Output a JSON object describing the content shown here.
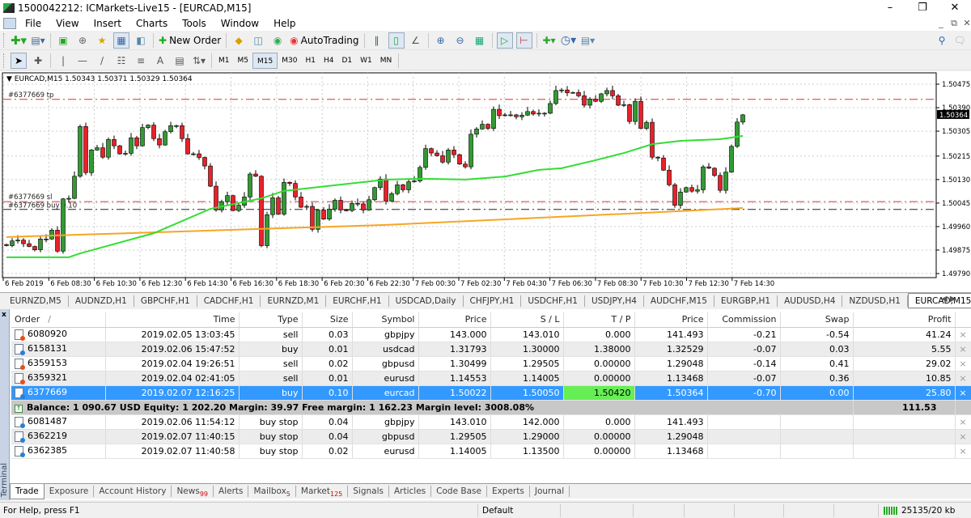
{
  "window": {
    "title": "1500042212: ICMarkets-Live15 - [EURCAD,M15]",
    "controls": [
      "minimize",
      "restore",
      "close"
    ]
  },
  "menu": {
    "items": [
      "File",
      "View",
      "Insert",
      "Charts",
      "Tools",
      "Window",
      "Help"
    ]
  },
  "toolbar": {
    "new_order": "New Order",
    "autotrading": "AutoTrading",
    "timeframes": [
      "M1",
      "M5",
      "M15",
      "M30",
      "H1",
      "H4",
      "D1",
      "W1",
      "MN"
    ],
    "active_timeframe": "M15"
  },
  "chart": {
    "header": "EURCAD,M15  1.50343 1.50371 1.50329 1.50364",
    "symbol": "EURCAD",
    "timeframe": "M15",
    "price_ticks": [
      "1.50475",
      "1.50390",
      "1.50305",
      "1.50215",
      "1.50130",
      "1.50045",
      "1.49960",
      "1.49875",
      "1.49790"
    ],
    "current_price": "1.50364",
    "date_ticks": [
      "6 Feb 2019",
      "6 Feb 08:30",
      "6 Feb 10:30",
      "6 Feb 12:30",
      "6 Feb 14:30",
      "6 Feb 16:30",
      "6 Feb 18:30",
      "6 Feb 20:30",
      "6 Feb 22:30",
      "7 Feb 00:30",
      "7 Feb 02:30",
      "7 Feb 04:30",
      "7 Feb 06:30",
      "7 Feb 08:30",
      "7 Feb 10:30",
      "7 Feb 12:30",
      "7 Feb 14:30"
    ],
    "levels": [
      {
        "label": "#6377669 tp",
        "price": 1.5042,
        "color": "#e03030"
      },
      {
        "label": "#6377669 sl",
        "price": 1.5005,
        "color": "#e03030"
      },
      {
        "label": "#6377669 buy 0.10",
        "price": 1.50022,
        "color": "#222222"
      }
    ],
    "colors": {
      "bull": "#339933",
      "bear": "#e8212a",
      "ma_fast": "#33dd33",
      "ma_slow": "#f5a623"
    },
    "first_open": 1.49895,
    "closes": [
      1.49891,
      1.49908,
      1.49911,
      1.49898,
      1.49888,
      1.49876,
      1.49915,
      1.49915,
      1.49947,
      1.49871,
      1.5006,
      1.50062,
      1.50142,
      1.50322,
      1.50155,
      1.50237,
      1.50245,
      1.50211,
      1.50275,
      1.50252,
      1.50223,
      1.50225,
      1.50281,
      1.50252,
      1.50318,
      1.50327,
      1.50278,
      1.50255,
      1.50303,
      1.50325,
      1.50325,
      1.50278,
      1.50223,
      1.50223,
      1.5021,
      1.50179,
      1.50106,
      1.5002,
      1.5005,
      1.50072,
      1.50018,
      1.50037,
      1.50067,
      1.5015,
      1.50142,
      1.49891,
      1.50003,
      1.50064,
      1.50005,
      1.5012,
      1.50116,
      1.50067,
      1.5003,
      1.50033,
      1.4995,
      1.5002,
      1.49987,
      1.50023,
      1.50055,
      1.5002,
      1.50018,
      1.50044,
      1.50042,
      1.5002,
      1.50057,
      1.50101,
      1.50132,
      1.50052,
      1.50079,
      1.50111,
      1.50093,
      1.50122,
      1.50125,
      1.50174,
      1.50242,
      1.50226,
      1.50216,
      1.50193,
      1.50237,
      1.5022,
      1.50186,
      1.50176,
      1.50294,
      1.50313,
      1.5033,
      1.50315,
      1.50384,
      1.50361,
      1.50364,
      1.50364,
      1.50357,
      1.50363,
      1.50376,
      1.50367,
      1.5037,
      1.5037,
      1.50405,
      1.50452,
      1.50454,
      1.50444,
      1.50445,
      1.50433,
      1.50399,
      1.50421,
      1.50413,
      1.5044,
      1.50452,
      1.50433,
      1.50399,
      1.50401,
      1.5034,
      1.50413,
      1.50315,
      1.50337,
      1.50211,
      1.50208,
      1.50164,
      1.50111,
      1.50037,
      1.50085,
      1.50101,
      1.50088,
      1.50093,
      1.50176,
      1.50171,
      1.50145,
      1.50091,
      1.50157,
      1.5025,
      1.50338,
      1.50364
    ],
    "ma_fast": [
      [
        0,
        1.49849
      ],
      [
        11,
        1.49849
      ],
      [
        13,
        1.49863
      ],
      [
        26,
        1.49936
      ],
      [
        36,
        1.50024
      ],
      [
        45,
        1.50062
      ],
      [
        49,
        1.50089
      ],
      [
        67,
        1.5013
      ],
      [
        74,
        1.50133
      ],
      [
        81,
        1.5013
      ],
      [
        88,
        1.50141
      ],
      [
        94,
        1.50165
      ],
      [
        98,
        1.50171
      ],
      [
        104,
        1.502
      ],
      [
        109,
        1.50226
      ],
      [
        114,
        1.50258
      ],
      [
        119,
        1.5027
      ],
      [
        126,
        1.50276
      ],
      [
        130,
        1.50288
      ]
    ],
    "ma_slow": [
      [
        0,
        1.49922
      ],
      [
        67,
        1.49966
      ],
      [
        113,
        1.5001
      ],
      [
        130,
        1.50027
      ]
    ]
  },
  "chart_tabs": {
    "items": [
      "EURNZD,M5",
      "AUDNZD,H1",
      "GBPCHF,H1",
      "CADCHF,H1",
      "EURNZD,M1",
      "EURCHF,H1",
      "USDCAD,Daily",
      "CHFJPY,H1",
      "USDCHF,H1",
      "USDJPY,H4",
      "AUDCHF,M15",
      "EURGBP,H1",
      "AUDUSD,H4",
      "NZDUSD,H1",
      "EURCAD,M15"
    ],
    "active": "EURCAD,M15"
  },
  "terminal": {
    "label": "Terminal",
    "columns": [
      "Order",
      "Time",
      "Type",
      "Size",
      "Symbol",
      "Price",
      "S / L",
      "T / P",
      "Price",
      "Commission",
      "Swap",
      "Profit"
    ],
    "sort_indicator": "/",
    "open_orders": [
      {
        "order": "6080920",
        "time": "2019.02.05 13:03:45",
        "type": "sell",
        "size": "0.03",
        "symbol": "gbpjpy",
        "price": "143.000",
        "sl": "143.010",
        "tp": "0.000",
        "cur": "141.493",
        "commission": "-0.21",
        "swap": "-0.54",
        "profit": "41.24"
      },
      {
        "order": "6158131",
        "time": "2019.02.06 15:47:52",
        "type": "buy",
        "size": "0.01",
        "symbol": "usdcad",
        "price": "1.31793",
        "sl": "1.30000",
        "tp": "1.38000",
        "cur": "1.32529",
        "commission": "-0.07",
        "swap": "0.03",
        "profit": "5.55"
      },
      {
        "order": "6359153",
        "time": "2019.02.04 19:26:51",
        "type": "sell",
        "size": "0.02",
        "symbol": "gbpusd",
        "price": "1.30499",
        "sl": "1.29505",
        "tp": "0.00000",
        "cur": "1.29048",
        "commission": "-0.14",
        "swap": "0.41",
        "profit": "29.02"
      },
      {
        "order": "6359321",
        "time": "2019.02.04 02:41:05",
        "type": "sell",
        "size": "0.01",
        "symbol": "eurusd",
        "price": "1.14553",
        "sl": "1.14005",
        "tp": "0.00000",
        "cur": "1.13468",
        "commission": "-0.07",
        "swap": "0.36",
        "profit": "10.85"
      },
      {
        "order": "6377669",
        "time": "2019.02.07 12:16:25",
        "type": "buy",
        "size": "0.10",
        "symbol": "eurcad",
        "price": "1.50022",
        "sl": "1.50050",
        "tp": "1.50420",
        "cur": "1.50364",
        "commission": "-0.70",
        "swap": "0.00",
        "profit": "25.80",
        "selected": true
      }
    ],
    "balance_line": "Balance: 1 090.67 USD  Equity: 1 202.20  Margin: 39.97  Free margin: 1 162.23  Margin level: 3008.08%",
    "total_profit": "111.53",
    "pending_orders": [
      {
        "order": "6081487",
        "time": "2019.02.06 11:54:12",
        "type": "buy stop",
        "size": "0.04",
        "symbol": "gbpjpy",
        "price": "143.010",
        "sl": "142.000",
        "tp": "0.000",
        "cur": "141.493"
      },
      {
        "order": "6362219",
        "time": "2019.02.07 11:40:15",
        "type": "buy stop",
        "size": "0.04",
        "symbol": "gbpusd",
        "price": "1.29505",
        "sl": "1.29000",
        "tp": "0.00000",
        "cur": "1.29048"
      },
      {
        "order": "6362385",
        "time": "2019.02.07 11:40:58",
        "type": "buy stop",
        "size": "0.02",
        "symbol": "eurusd",
        "price": "1.14005",
        "sl": "1.13500",
        "tp": "0.00000",
        "cur": "1.13468"
      }
    ],
    "close_glyph": "×",
    "tabs": [
      {
        "label": "Trade"
      },
      {
        "label": "Exposure"
      },
      {
        "label": "Account History"
      },
      {
        "label": "News",
        "badge": "99"
      },
      {
        "label": "Alerts"
      },
      {
        "label": "Mailbox",
        "badge": "5"
      },
      {
        "label": "Market",
        "badge": "125"
      },
      {
        "label": "Signals"
      },
      {
        "label": "Articles"
      },
      {
        "label": "Code Base"
      },
      {
        "label": "Experts"
      },
      {
        "label": "Journal"
      }
    ],
    "active_tab": "Trade"
  },
  "status": {
    "help": "For Help, press F1",
    "profile": "Default",
    "traffic": "25135/20 kb"
  }
}
